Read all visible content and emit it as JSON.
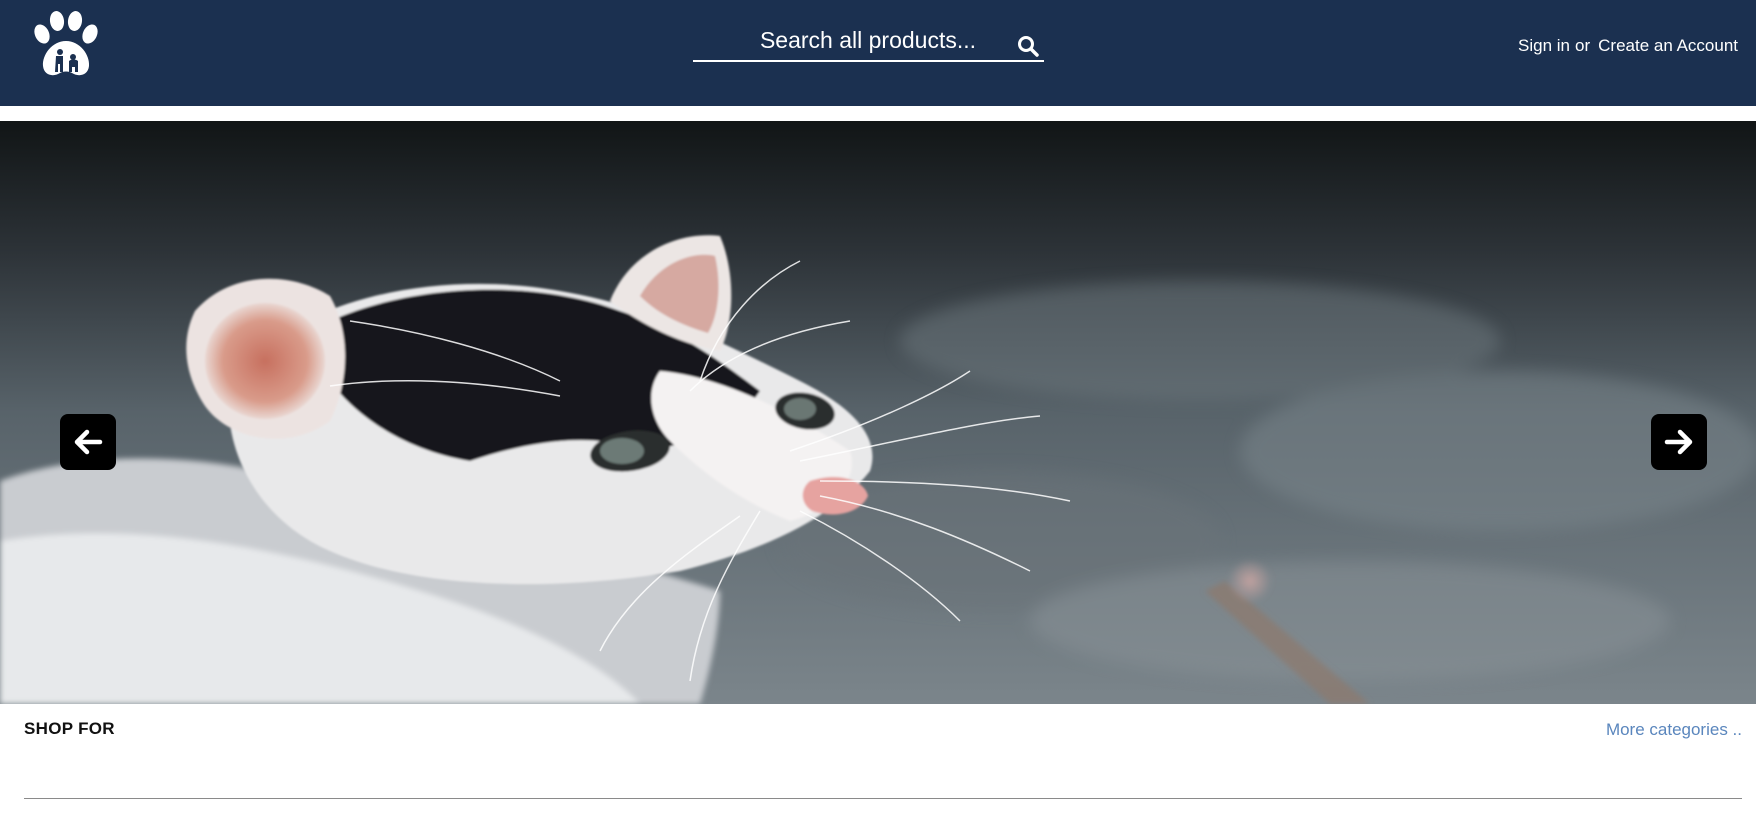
{
  "header": {
    "background": "#1b3050",
    "logo_icon": "paw-logo-icon",
    "search": {
      "placeholder": "Search all products...",
      "icon": "search-icon"
    },
    "account": {
      "sign_in": "Sign in",
      "separator": "or",
      "create_account": "Create an Account"
    }
  },
  "hero": {
    "image": "kitten-banner",
    "prev_icon": "arrow-left-icon",
    "next_icon": "arrow-right-icon"
  },
  "shop": {
    "title": "SHOP FOR",
    "more_link": "More categories ..",
    "link_color": "#5a86bd"
  }
}
